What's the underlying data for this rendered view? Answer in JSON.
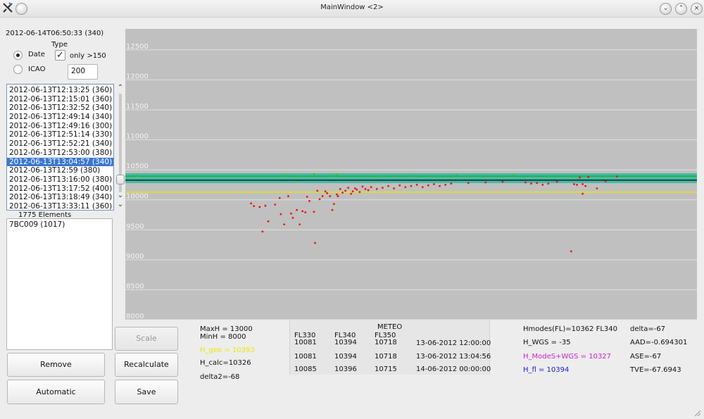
{
  "window": {
    "title": "MainWindow <2>",
    "app_icon": "x-logo-icon"
  },
  "header_timestamp": "2012-06-14T06:50:33 (340)",
  "type_group": {
    "label": "Type",
    "date_label": "Date",
    "icao_label": "ICAO",
    "selected": "Date",
    "only_label": "only >150",
    "only_checked": true,
    "threshold_value": "200"
  },
  "flights_list": {
    "items": [
      "2012-06-13T12:13:25 (360)",
      "2012-06-13T12:15:01 (360)",
      "2012-06-13T12:32:52 (340)",
      "2012-06-13T12:49:14 (340)",
      "2012-06-13T12:49:16 (300)",
      "2012-06-13T12:51:14 (330)",
      "2012-06-13T12:52:21 (340)",
      "2012-06-13T12:53:00 (380)",
      "2012-06-13T13:04:57 (340)",
      "2012-06-13T12:59 (380)",
      "2012-06-13T13:16:00 (380)",
      "2012-06-13T13:17:52 (400)",
      "2012-06-13T13:18:49 (340)",
      "2012-06-13T13:33:11 (360)"
    ],
    "selected_index": 8,
    "count_label": "1775 Elements"
  },
  "aircraft_list": {
    "items": [
      "7BC009 (1017)"
    ]
  },
  "buttons": {
    "scale": "Scale",
    "remove": "Remove",
    "recalculate": "Recalculate",
    "automatic": "Automatic",
    "save": "Save"
  },
  "left_info": {
    "maxh": "MaxH = 13000",
    "minh": "MinH = 8000",
    "h_geo": "H_geo = 10393",
    "h_calc": "H_calc=10326",
    "delta2": "delta2=-68"
  },
  "meteo": {
    "title": "METEO",
    "headers": [
      "FL330",
      "FL340",
      "FL350"
    ],
    "rows": [
      [
        "10081",
        "10394",
        "10718",
        "13-06-2012 12:00:00"
      ],
      [
        "10081",
        "10394",
        "10718",
        "13-06-2012 13:04:56"
      ],
      [
        "10085",
        "10396",
        "10715",
        "14-06-2012 00:00:00"
      ]
    ]
  },
  "right_info": {
    "hmodes": "Hmodes(FL)=10362 FL340",
    "h_wgs": "H_WGS = -35",
    "h_modes_wgs": "H_ModeS+WGS = 10327",
    "h_fl": "H_fl = 10394",
    "delta": "delta=-67",
    "aad": "AAD=-0.694301",
    "ase": "ASE=-67",
    "tve": "TVE=-67.6943"
  },
  "colors": {
    "h_geo": "#e8e800",
    "h_modes_wgs": "#cc22cc",
    "h_fl": "#1a1acc",
    "selection": "#3a77cf",
    "plot_bg": "#c0c0c0",
    "band": "#2fb8a0",
    "points": "#ee1111",
    "green_points": "#22cc22"
  },
  "chart_data": {
    "type": "scatter",
    "y_ticks": [
      "12500",
      "12000",
      "11500",
      "11000",
      "10500",
      "10000",
      "9500",
      "9000",
      "8500",
      "8000"
    ],
    "ylim": [
      8000,
      12850
    ],
    "xlim": [
      0,
      1
    ],
    "grid": true,
    "reference_lines": [
      {
        "y": 10360,
        "color": "#2fb8a0",
        "kind": "band"
      },
      {
        "y": 10394,
        "color": "#22aa22"
      },
      {
        "y": 10327,
        "color": "#111111"
      },
      {
        "y": 10128,
        "color": "#e8e800"
      }
    ],
    "points": [
      [
        0.22,
        9940
      ],
      [
        0.225,
        9895
      ],
      [
        0.235,
        9880
      ],
      [
        0.24,
        9470
      ],
      [
        0.245,
        9900
      ],
      [
        0.25,
        9640
      ],
      [
        0.262,
        9920
      ],
      [
        0.27,
        10030
      ],
      [
        0.272,
        9760
      ],
      [
        0.278,
        9590
      ],
      [
        0.285,
        10060
      ],
      [
        0.29,
        9770
      ],
      [
        0.293,
        9700
      ],
      [
        0.3,
        9830
      ],
      [
        0.305,
        9590
      ],
      [
        0.31,
        9810
      ],
      [
        0.315,
        9790
      ],
      [
        0.318,
        10050
      ],
      [
        0.322,
        9980
      ],
      [
        0.33,
        9800
      ],
      [
        0.332,
        9280
      ],
      [
        0.336,
        10150
      ],
      [
        0.34,
        10010
      ],
      [
        0.345,
        10060
      ],
      [
        0.35,
        10140
      ],
      [
        0.353,
        10110
      ],
      [
        0.358,
        10060
      ],
      [
        0.362,
        9830
      ],
      [
        0.365,
        9930
      ],
      [
        0.37,
        10090
      ],
      [
        0.372,
        10060
      ],
      [
        0.376,
        10180
      ],
      [
        0.38,
        10120
      ],
      [
        0.385,
        10150
      ],
      [
        0.39,
        10200
      ],
      [
        0.395,
        10100
      ],
      [
        0.398,
        10140
      ],
      [
        0.402,
        10190
      ],
      [
        0.405,
        10170
      ],
      [
        0.41,
        10130
      ],
      [
        0.415,
        10220
      ],
      [
        0.42,
        10180
      ],
      [
        0.425,
        10160
      ],
      [
        0.43,
        10210
      ],
      [
        0.44,
        10180
      ],
      [
        0.45,
        10200
      ],
      [
        0.46,
        10230
      ],
      [
        0.47,
        10190
      ],
      [
        0.48,
        10240
      ],
      [
        0.49,
        10210
      ],
      [
        0.5,
        10230
      ],
      [
        0.51,
        10250
      ],
      [
        0.52,
        10210
      ],
      [
        0.53,
        10240
      ],
      [
        0.54,
        10260
      ],
      [
        0.55,
        10230
      ],
      [
        0.56,
        10250
      ],
      [
        0.57,
        10270
      ],
      [
        0.6,
        10280
      ],
      [
        0.63,
        10290
      ],
      [
        0.66,
        10300
      ],
      [
        0.7,
        10290
      ],
      [
        0.71,
        10270
      ],
      [
        0.72,
        10280
      ],
      [
        0.73,
        10250
      ],
      [
        0.74,
        10270
      ],
      [
        0.755,
        10300
      ],
      [
        0.78,
        9140
      ],
      [
        0.785,
        10260
      ],
      [
        0.79,
        10250
      ],
      [
        0.8,
        10260
      ],
      [
        0.8,
        10100
      ],
      [
        0.805,
        10230
      ],
      [
        0.81,
        10380
      ],
      [
        0.795,
        10370
      ],
      [
        0.825,
        10190
      ],
      [
        0.84,
        10310
      ],
      [
        0.86,
        10390
      ]
    ],
    "green_points": [
      [
        0.02,
        10400
      ],
      [
        0.28,
        10400
      ],
      [
        0.3,
        10390
      ],
      [
        0.33,
        10430
      ],
      [
        0.36,
        10400
      ],
      [
        0.37,
        10420
      ],
      [
        0.44,
        10390
      ],
      [
        0.5,
        10400
      ],
      [
        0.58,
        10410
      ],
      [
        0.62,
        10400
      ],
      [
        0.68,
        10410
      ],
      [
        0.74,
        10390
      ]
    ]
  }
}
